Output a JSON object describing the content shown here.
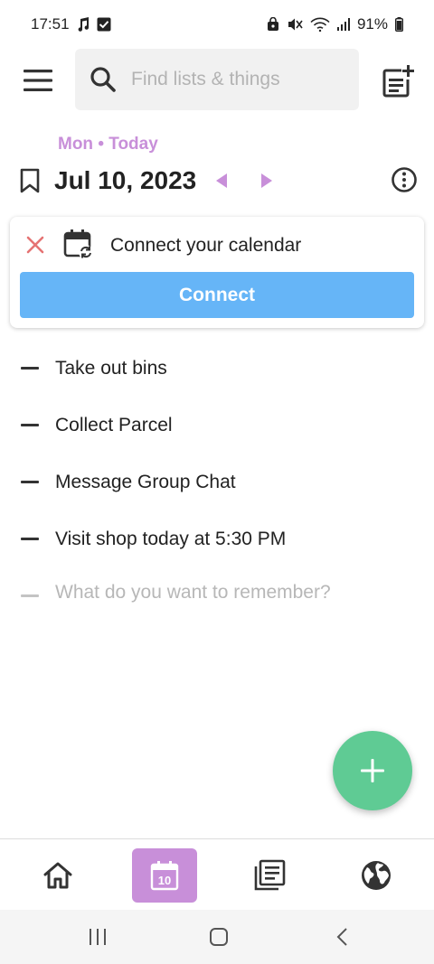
{
  "status_bar": {
    "time": "17:51",
    "battery": "91%"
  },
  "search": {
    "placeholder": "Find lists & things"
  },
  "date_header": {
    "day_label": "Mon • Today",
    "date": "Jul 10, 2023"
  },
  "calendar_card": {
    "text": "Connect your calendar",
    "button_label": "Connect"
  },
  "tasks": [
    {
      "label": "Take out bins"
    },
    {
      "label": "Collect Parcel"
    },
    {
      "label": "Message Group Chat"
    },
    {
      "label": "Visit shop today at 5:30 PM"
    }
  ],
  "new_task": {
    "placeholder": "What do you want to remember?"
  },
  "bottom_nav": {
    "calendar_day": "10",
    "active": "calendar"
  },
  "colors": {
    "accent_purple": "#c88fd9",
    "connect_blue": "#66b5f7",
    "fab_green": "#5fcb94",
    "close_red": "#e57373"
  },
  "icons": {
    "menu": "hamburger-menu-icon",
    "search": "search-icon",
    "new_list": "note-add-icon",
    "bookmark": "bookmark-icon",
    "prev": "triangle-left-icon",
    "next": "triangle-right-icon",
    "more": "more-vertical-icon",
    "close": "close-icon",
    "calendar_sync": "calendar-sync-icon",
    "fab": "plus-icon",
    "home": "home-icon",
    "calendar": "calendar-icon",
    "lists": "lists-icon",
    "explore": "globe-icon"
  }
}
